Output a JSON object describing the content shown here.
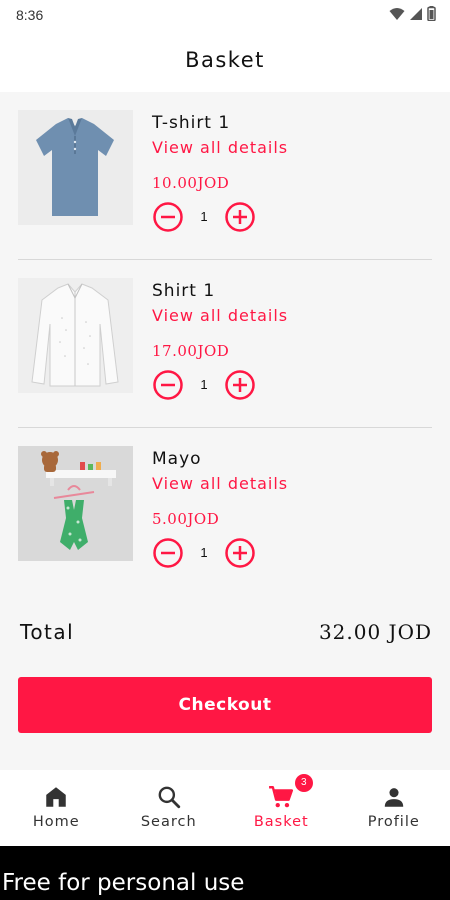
{
  "status_bar": {
    "time": "8:36"
  },
  "header": {
    "title": "Basket"
  },
  "items": [
    {
      "name": "T-shirt 1",
      "link": "View all details",
      "price": "10.00JOD",
      "quantity": "1"
    },
    {
      "name": "Shirt 1",
      "link": "View all details",
      "price": "17.00JOD",
      "quantity": "1"
    },
    {
      "name": "Mayo",
      "link": "View all details",
      "price": "5.00JOD",
      "quantity": "1"
    }
  ],
  "summary": {
    "total_label": "Total",
    "total_value": "32.00 JOD"
  },
  "checkout": {
    "label": "Checkout"
  },
  "nav": {
    "items": [
      {
        "label": "Home",
        "icon": "home-icon"
      },
      {
        "label": "Search",
        "icon": "search-icon"
      },
      {
        "label": "Basket",
        "icon": "cart-icon",
        "badge": "3",
        "active": true
      },
      {
        "label": "Profile",
        "icon": "person-icon"
      }
    ]
  },
  "watermark": {
    "text": "Free for personal use"
  },
  "colors": {
    "accent": "#ff1744",
    "background": "#f6f6f6",
    "surface": "#ffffff"
  }
}
